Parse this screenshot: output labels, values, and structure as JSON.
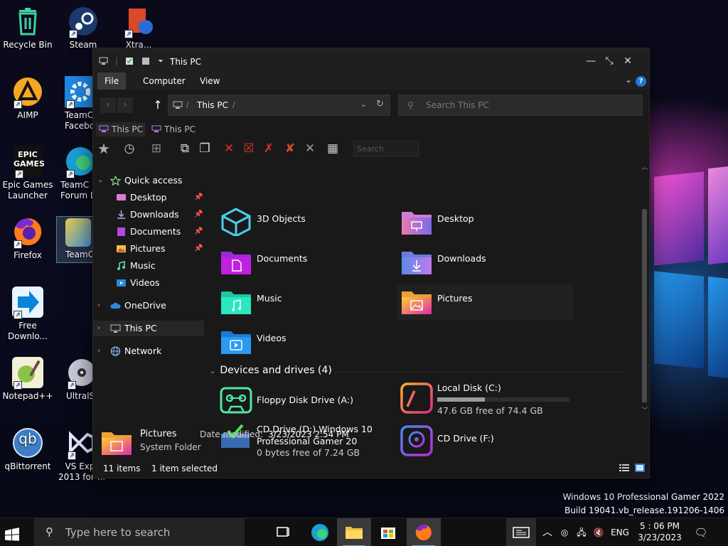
{
  "desktop": {
    "icons": [
      {
        "label": "Recycle Bin"
      },
      {
        "label": "Steam"
      },
      {
        "label": "Xtra..."
      },
      {
        "label": "AIMP"
      },
      {
        "label": "TeamC Facebo"
      },
      {
        "label": "Epic Games Launcher"
      },
      {
        "label": "TeamC Forum L"
      },
      {
        "label": "Firefox"
      },
      {
        "label": "TeamC"
      },
      {
        "label": "Free Downlo..."
      },
      {
        "label": "Notepad++"
      },
      {
        "label": "UltraIS"
      },
      {
        "label": "qBittorrent"
      },
      {
        "label": "VS Expr 2013 for ..."
      }
    ],
    "epic_logo_text": "EPIC GAMES",
    "qb_logo_text": "qb"
  },
  "explorer": {
    "title": "This PC",
    "window_controls": {
      "minimize": "—",
      "maximize": "⤡",
      "close": "✕"
    },
    "ribbon_tabs": [
      "File",
      "Computer",
      "View"
    ],
    "help_label": "?",
    "address": {
      "location": "This PC",
      "separator": "/"
    },
    "search": {
      "placeholder": "Search This PC"
    },
    "subtabs": [
      "This PC",
      "This PC"
    ],
    "toolbar_search_placeholder": "Search",
    "nav": {
      "quick_access": "Quick access",
      "items": [
        {
          "label": "Desktop",
          "pinned": true
        },
        {
          "label": "Downloads",
          "pinned": true
        },
        {
          "label": "Documents",
          "pinned": true
        },
        {
          "label": "Pictures",
          "pinned": true
        },
        {
          "label": "Music",
          "pinned": false
        },
        {
          "label": "Videos",
          "pinned": false
        }
      ],
      "onedrive": "OneDrive",
      "this_pc": "This PC",
      "network": "Network"
    },
    "folders": [
      {
        "label": "3D Objects"
      },
      {
        "label": "Desktop"
      },
      {
        "label": "Documents"
      },
      {
        "label": "Downloads"
      },
      {
        "label": "Music"
      },
      {
        "label": "Pictures"
      },
      {
        "label": "Videos"
      }
    ],
    "devices_header": "Devices and drives (4)",
    "drives": [
      {
        "name": "Floppy Disk Drive (A:)"
      },
      {
        "name": "Local Disk (C:)",
        "free": "47.6 GB free of 74.4 GB",
        "used_fraction": 0.36
      },
      {
        "name_line1": "CD Drive (D:) Windows 10",
        "name_line2": "Professional Gamer 20",
        "free": "0 bytes free of 7.24 GB"
      },
      {
        "name": "CD Drive (F:)"
      }
    ],
    "details": {
      "name": "Pictures",
      "type": "System Folder",
      "modified_label": "Date modified:",
      "modified_value": "3/23/2023 2:54 PM"
    },
    "status": {
      "items": "11 items",
      "selected": "1 item selected"
    }
  },
  "watermark": {
    "line1": "Windows 10 Professional Gamer 2022",
    "line2": "Build 19041.vb_release.191206-1406"
  },
  "taskbar": {
    "search_placeholder": "Type here to search",
    "language": "ENG",
    "time": "5 : 06 PM",
    "date": "3/23/2023"
  },
  "colors": {
    "window_bg": "#191919",
    "accent_blue": "#1e78d6",
    "red_icon": "#e0302a"
  }
}
